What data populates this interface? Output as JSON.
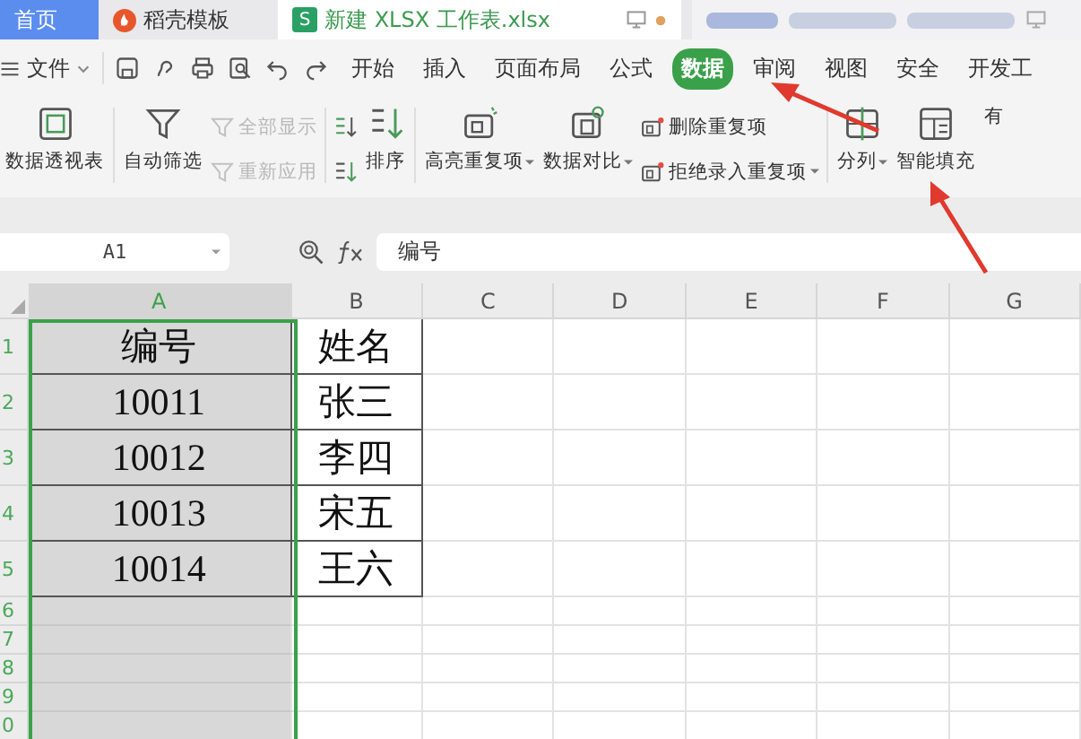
{
  "tabs": [
    {
      "kind": "home",
      "label": "首页",
      "selected": false
    },
    {
      "kind": "docer",
      "label": "稻壳模板",
      "selected": false
    },
    {
      "kind": "sheet",
      "label": "新建 XLSX 工作表.xlsx",
      "icon_text": "S",
      "selected": true
    },
    {
      "kind": "blurred",
      "selected": false
    }
  ],
  "menu": {
    "file": "文件",
    "tabs": [
      {
        "label": "开始",
        "selected": false
      },
      {
        "label": "插入",
        "selected": false
      },
      {
        "label": "页面布局",
        "selected": false
      },
      {
        "label": "公式",
        "selected": false
      },
      {
        "label": "数据",
        "selected": true
      },
      {
        "label": "审阅",
        "selected": false
      },
      {
        "label": "视图",
        "selected": false
      },
      {
        "label": "安全",
        "selected": false
      },
      {
        "label": "开发工",
        "selected": false
      }
    ]
  },
  "ribbon": [
    {
      "items": [
        {
          "kind": "large",
          "label": "数据透视表",
          "disabled": false,
          "dropdown": false
        }
      ]
    },
    {
      "items": [
        {
          "kind": "large",
          "label": "自动筛选",
          "disabled": false,
          "dropdown": false
        },
        {
          "kind": "stack",
          "items": [
            {
              "label": "全部显示",
              "disabled": true,
              "dropdown": false
            },
            {
              "label": "重新应用",
              "disabled": true,
              "dropdown": false
            }
          ]
        }
      ]
    },
    {
      "items": [
        {
          "kind": "stack",
          "items": [
            {
              "disabled": false,
              "dropdown": false
            },
            {
              "disabled": false,
              "dropdown": false
            }
          ]
        },
        {
          "kind": "large",
          "label": "排序",
          "disabled": false,
          "dropdown": false
        }
      ]
    },
    {
      "items": [
        {
          "kind": "large",
          "label": "高亮重复项",
          "disabled": false,
          "dropdown": true
        },
        {
          "kind": "large",
          "label": "数据对比",
          "disabled": false,
          "dropdown": true
        },
        {
          "kind": "stack",
          "items": [
            {
              "label": "删除重复项",
              "disabled": false,
              "dropdown": false
            },
            {
              "label": "拒绝录入重复项",
              "disabled": false,
              "dropdown": true
            }
          ]
        }
      ]
    },
    {
      "items": [
        {
          "kind": "large",
          "label": "分列",
          "disabled": false,
          "dropdown": true
        },
        {
          "kind": "large",
          "label": "智能填充",
          "disabled": false,
          "dropdown": false
        },
        {
          "kind": "large",
          "label": "有",
          "disabled": false,
          "dropdown": false
        }
      ]
    }
  ],
  "name_box": "A1",
  "formula": "编号",
  "columns": [
    {
      "label": "A",
      "selected": true
    },
    {
      "label": "B",
      "selected": false
    },
    {
      "label": "C",
      "selected": false
    },
    {
      "label": "D",
      "selected": false
    },
    {
      "label": "E",
      "selected": false
    },
    {
      "label": "F",
      "selected": false
    },
    {
      "label": "G",
      "selected": false
    }
  ],
  "rows": [
    {
      "number": "1",
      "cells": [
        "编号",
        "姓名"
      ]
    },
    {
      "number": "2",
      "cells": [
        "10011",
        "张三"
      ]
    },
    {
      "number": "3",
      "cells": [
        "10012",
        "李四"
      ]
    },
    {
      "number": "4",
      "cells": [
        "10013",
        "宋五"
      ]
    },
    {
      "number": "5",
      "cells": [
        "10014",
        "王六"
      ]
    },
    {
      "number": "6",
      "cells": []
    },
    {
      "number": "7",
      "cells": []
    },
    {
      "number": "8",
      "cells": []
    },
    {
      "number": "9",
      "cells": []
    },
    {
      "number": "0",
      "cells": []
    }
  ]
}
